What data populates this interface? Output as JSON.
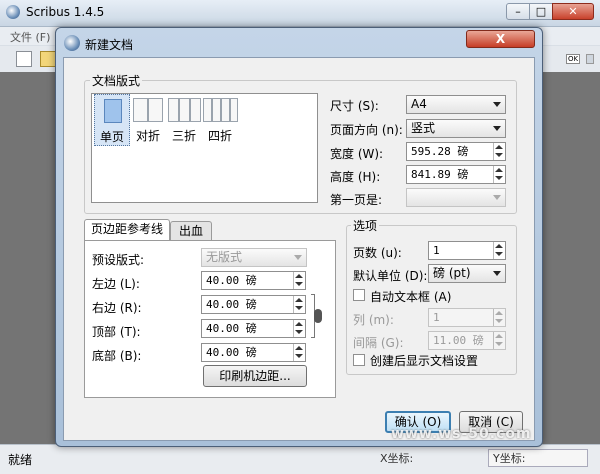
{
  "app": {
    "title": "Scribus 1.4.5",
    "menu_first": "文件 (F)",
    "status": "就绪",
    "status_right": "X坐标:",
    "status_right2": "Y坐标:"
  },
  "dialog": {
    "title": "新建文档",
    "close_glyph": "X",
    "layout_group": {
      "title": "文档版式",
      "options": [
        "单页",
        "对折",
        "三折",
        "四折"
      ],
      "selected": "单页"
    },
    "size": {
      "label": "尺寸 (S):",
      "value": "A4"
    },
    "orientation": {
      "label": "页面方向 (n):",
      "value": "竖式"
    },
    "width": {
      "label": "宽度 (W):",
      "value": "595.28 磅"
    },
    "height": {
      "label": "高度 (H):",
      "value": "841.89 磅"
    },
    "first_page": {
      "label": "第一页是:",
      "value": ""
    },
    "tabs": [
      "页边距参考线",
      "出血"
    ],
    "active_tab": "页边距参考线",
    "margins": {
      "preset": {
        "label": "预设版式:",
        "value": "无版式"
      },
      "left": {
        "label": "左边 (L):",
        "value": "40.00 磅"
      },
      "right": {
        "label": "右边 (R):",
        "value": "40.00 磅"
      },
      "top": {
        "label": "顶部 (T):",
        "value": "40.00 磅"
      },
      "bottom": {
        "label": "底部 (B):",
        "value": "40.00 磅"
      },
      "printer_margins_button": "印刷机边距..."
    },
    "options": {
      "title": "选项",
      "pages": {
        "label": "页数 (u):",
        "value": "1"
      },
      "unit": {
        "label": "默认单位 (D):",
        "value": "磅 (pt)"
      },
      "auto_frames": {
        "label": "自动文本框 (A)",
        "checked": false
      },
      "columns": {
        "label": "列 (m):",
        "value": "1"
      },
      "gap": {
        "label": "间隔 (G):",
        "value": "11.00 磅"
      },
      "show_settings": {
        "label": "创建后显示文档设置",
        "checked": false
      }
    },
    "ok_button": "确认 (O)",
    "cancel_button": "取消 (C)"
  },
  "watermark": "www.ws-50.com"
}
